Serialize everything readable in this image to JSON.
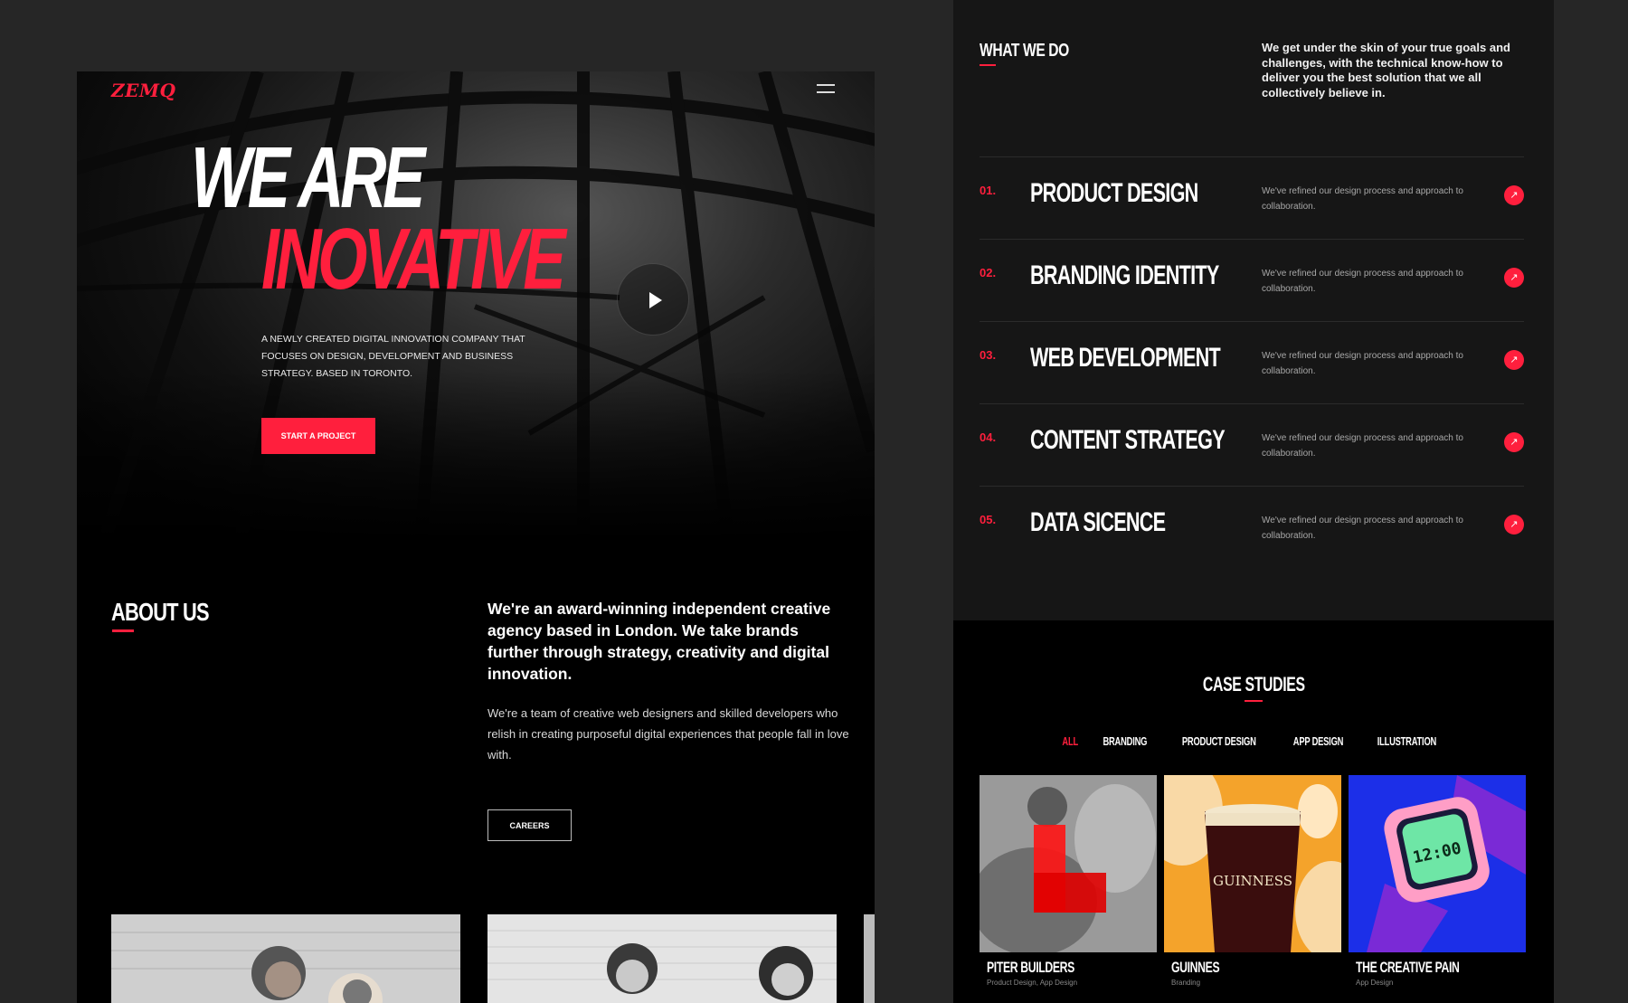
{
  "colors": {
    "accent": "#ff1f3d",
    "panel_dark": "#161616",
    "page_bg": "#262626"
  },
  "hero": {
    "logo": "ZEMQ",
    "menu_icon": "hamburger-icon",
    "headline_line1": "WE ARE",
    "headline_line2": "INOVATIVE",
    "description": "A NEWLY CREATED DIGITAL INNOVATION COMPANY THAT FOCUSES ON DESIGN, DEVELOPMENT AND BUSINESS STRATEGY. BASED IN TORONTO.",
    "cta_label": "START A PROJECT",
    "play_icon": "play-icon"
  },
  "about": {
    "title": "ABOUT US",
    "lead": "We're an award-winning independent creative agency based in London. We take brands further through strategy, creativity and digital innovation.",
    "body": "We're a team of creative web designers and skilled developers who relish in creating purposeful digital experiences that people fall in love with.",
    "careers_label": "CAREERS"
  },
  "what_we_do": {
    "title": "WHAT WE DO",
    "intro": "We get under the skin of your true goals and challenges, with the technical know-how to deliver you the best solution that we all collectively believe in.",
    "services": [
      {
        "num": "01.",
        "title": "PRODUCT DESIGN",
        "desc": "We've refined our design process and approach to collaboration."
      },
      {
        "num": "02.",
        "title": "BRANDING IDENTITY",
        "desc": "We've refined our design process and approach to collaboration."
      },
      {
        "num": "03.",
        "title": "WEB DEVELOPMENT",
        "desc": "We've refined our design process and approach to collaboration."
      },
      {
        "num": "04.",
        "title": "CONTENT STRATEGY",
        "desc": "We've refined our design process and approach to collaboration."
      },
      {
        "num": "05.",
        "title": "DATA SICENCE",
        "desc": "We've refined our design process and approach to collaboration."
      }
    ],
    "arrow_icon": "arrow-up-right-icon"
  },
  "case_studies": {
    "title": "CASE STUDIES",
    "filters": [
      "ALL",
      "BRANDING",
      "PRODUCT DESIGN",
      "APP DESIGN",
      "ILLUSTRATION"
    ],
    "active_filter": "ALL",
    "cases": [
      {
        "name": "PITER BUILDERS",
        "tags": "Product Design, App Design"
      },
      {
        "name": "GUINNES",
        "tags": "Branding",
        "image_text": "GUINNESS"
      },
      {
        "name": "THE CREATIVE PAIN",
        "tags": "App Design",
        "image_text": "12:00"
      }
    ]
  }
}
